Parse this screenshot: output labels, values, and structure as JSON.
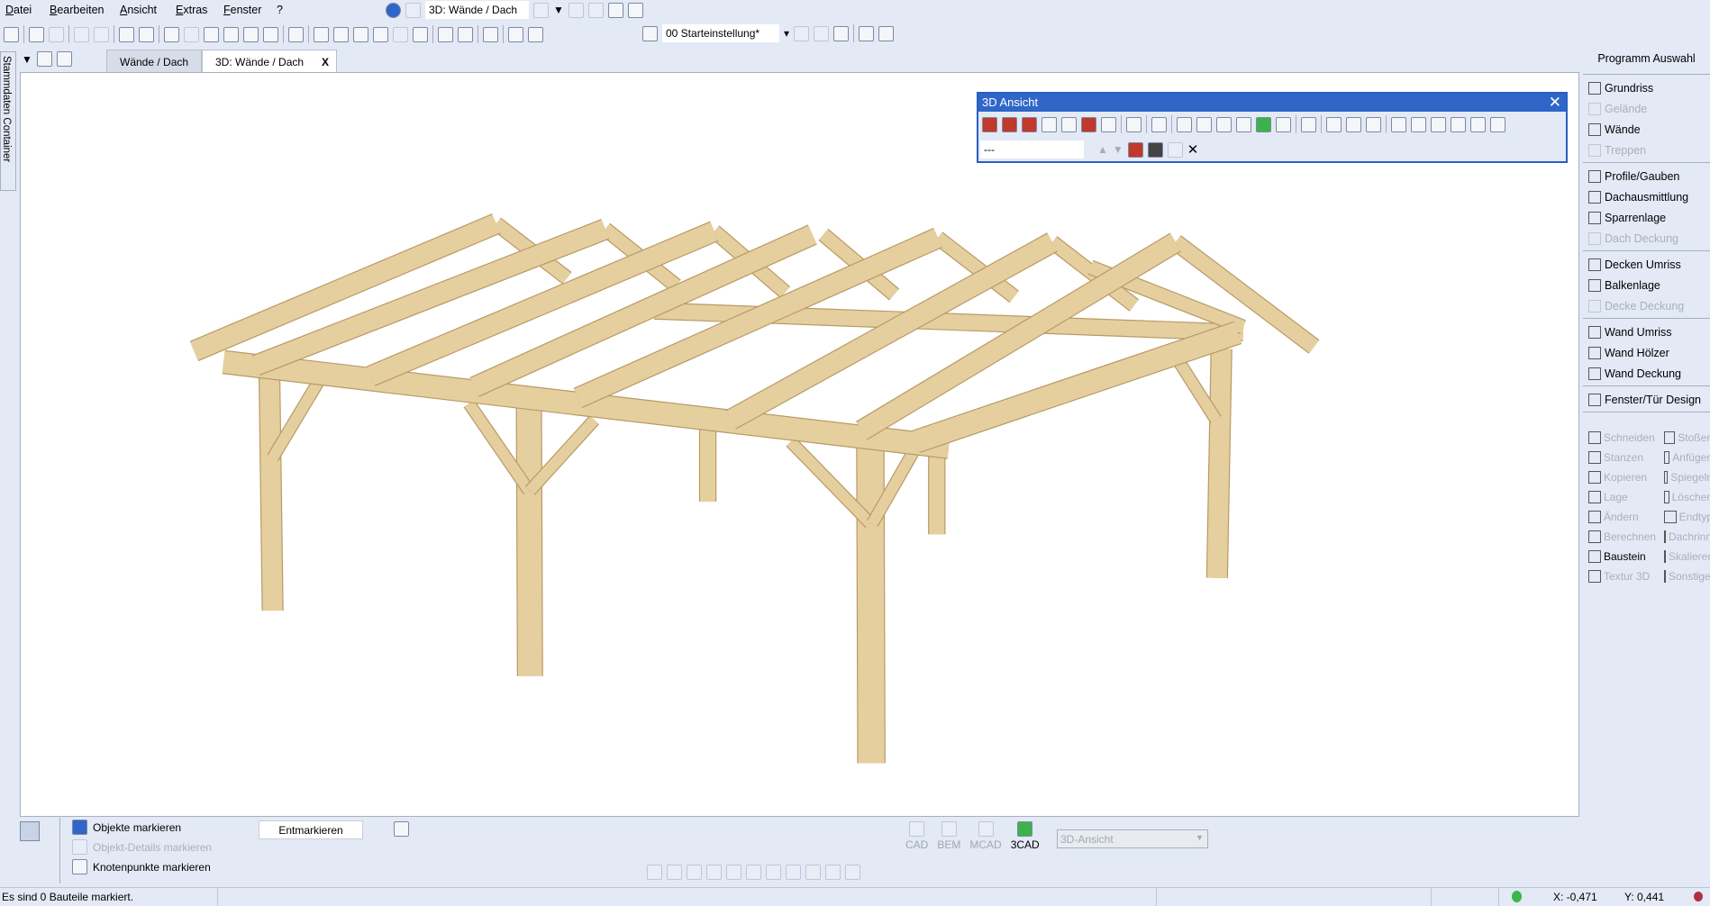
{
  "menu": [
    "Datei",
    "Bearbeiten",
    "Ansicht",
    "Extras",
    "Fenster",
    "?"
  ],
  "view_selector": "3D: Wände / Dach",
  "preset_selector": "00 Starteinstellung*",
  "left_strip": "Stammdaten Container",
  "tabs": [
    {
      "label": "Wände / Dach"
    },
    {
      "label": "3D: Wände / Dach",
      "close": "X"
    }
  ],
  "dialog": {
    "title": "3D Ansicht",
    "close": "✕",
    "field": "---"
  },
  "right_panel": {
    "title": "Programm Auswahl",
    "groups": [
      [
        {
          "label": "Grundriss",
          "on": true
        },
        {
          "label": "Gelände",
          "on": false
        },
        {
          "label": "Wände",
          "on": true
        },
        {
          "label": "Treppen",
          "on": false
        }
      ],
      [
        {
          "label": "Profile/Gauben",
          "on": true
        },
        {
          "label": "Dachausmittlung",
          "on": true
        },
        {
          "label": "Sparrenlage",
          "on": true
        },
        {
          "label": "Dach Deckung",
          "on": false
        }
      ],
      [
        {
          "label": "Decken Umriss",
          "on": true
        },
        {
          "label": "Balkenlage",
          "on": true
        },
        {
          "label": "Decke Deckung",
          "on": false
        }
      ],
      [
        {
          "label": "Wand Umriss",
          "on": true
        },
        {
          "label": "Wand Hölzer",
          "on": true
        },
        {
          "label": "Wand Deckung",
          "on": true
        }
      ],
      [
        {
          "label": "Fenster/Tür Design",
          "on": true
        }
      ]
    ],
    "tools": [
      "Schneiden",
      "Stoßen",
      "Stanzen",
      "Anfügen",
      "Kopieren",
      "Spiegeln",
      "Lage",
      "Löschen",
      "Ändern",
      "Endtyp",
      "Berechnen",
      "Dachrinne",
      "Baustein",
      "Skalieren",
      "Textur 3D",
      "Sonstiges"
    ]
  },
  "bottom": {
    "mark_objects": "Objekte markieren",
    "mark_details": "Objekt-Details markieren",
    "mark_nodes": "Knotenpunkte markieren",
    "unmark": "Entmarkieren",
    "modes": [
      "CAD",
      "BEM",
      "MCAD",
      "3CAD"
    ],
    "view_combo": "3D-Ansicht"
  },
  "status": {
    "message": "Es sind 0 Bauteile markiert.",
    "x": "X: -0,471",
    "y": "Y: 0,441"
  },
  "colors": {
    "wood": "#e6cf9f",
    "wood_dark": "#b99a66",
    "accent": "#2f66c8"
  }
}
